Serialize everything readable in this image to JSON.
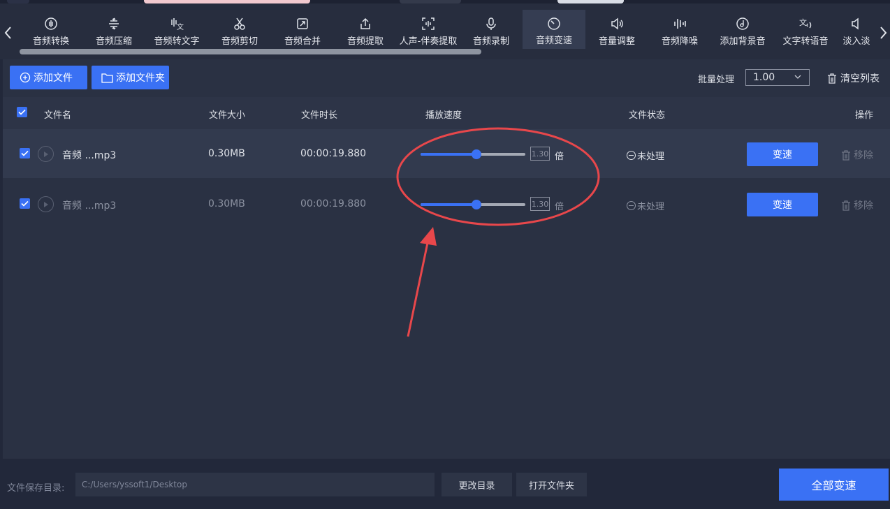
{
  "toolbar": {
    "items": [
      {
        "label": "音频转换",
        "icon": "audio-convert-icon"
      },
      {
        "label": "音频压缩",
        "icon": "compress-icon"
      },
      {
        "label": "音频转文字",
        "icon": "audio-to-text-icon"
      },
      {
        "label": "音频剪切",
        "icon": "scissors-icon"
      },
      {
        "label": "音频合并",
        "icon": "merge-icon"
      },
      {
        "label": "音频提取",
        "icon": "extract-icon"
      },
      {
        "label": "人声-伴奏提取",
        "icon": "vocal-extract-icon"
      },
      {
        "label": "音频录制",
        "icon": "microphone-icon"
      },
      {
        "label": "音频变速",
        "icon": "speed-gauge-icon",
        "active": true
      },
      {
        "label": "音量调整",
        "icon": "volume-icon"
      },
      {
        "label": "音频降噪",
        "icon": "denoise-icon"
      },
      {
        "label": "添加背景音",
        "icon": "music-disc-icon"
      },
      {
        "label": "文字转语音",
        "icon": "text-to-speech-icon"
      },
      {
        "label": "淡入淡",
        "icon": "fade-icon"
      }
    ]
  },
  "actions": {
    "add_file": "添加文件",
    "add_folder": "添加文件夹",
    "batch_label": "批量处理",
    "batch_value": "1.00",
    "clear_list": "清空列表"
  },
  "table": {
    "headers": {
      "name": "文件名",
      "size": "文件大小",
      "duration": "文件时长",
      "speed": "播放速度",
      "status": "文件状态",
      "action": "操作"
    },
    "rows": [
      {
        "name": "音频 ...mp3",
        "size": "0.30MB",
        "duration": "00:00:19.880",
        "speed": "1.30",
        "speed_fraction": 0.53,
        "unit": "倍",
        "status": "未处理",
        "action": "变速",
        "remove": "移除",
        "checked": true
      },
      {
        "name": "音频 ...mp3",
        "size": "0.30MB",
        "duration": "00:00:19.880",
        "speed": "1.30",
        "speed_fraction": 0.53,
        "unit": "倍",
        "status": "未处理",
        "action": "变速",
        "remove": "移除",
        "checked": true
      }
    ]
  },
  "footer": {
    "save_label": "文件保存目录:",
    "save_path": "C:/Users/yssoft1/Desktop",
    "change_dir": "更改目录",
    "open_folder": "打开文件夹",
    "convert_all": "全部变速"
  },
  "colors": {
    "accent": "#3a71f4",
    "annotation": "#e8474b",
    "background": "#22283a"
  }
}
